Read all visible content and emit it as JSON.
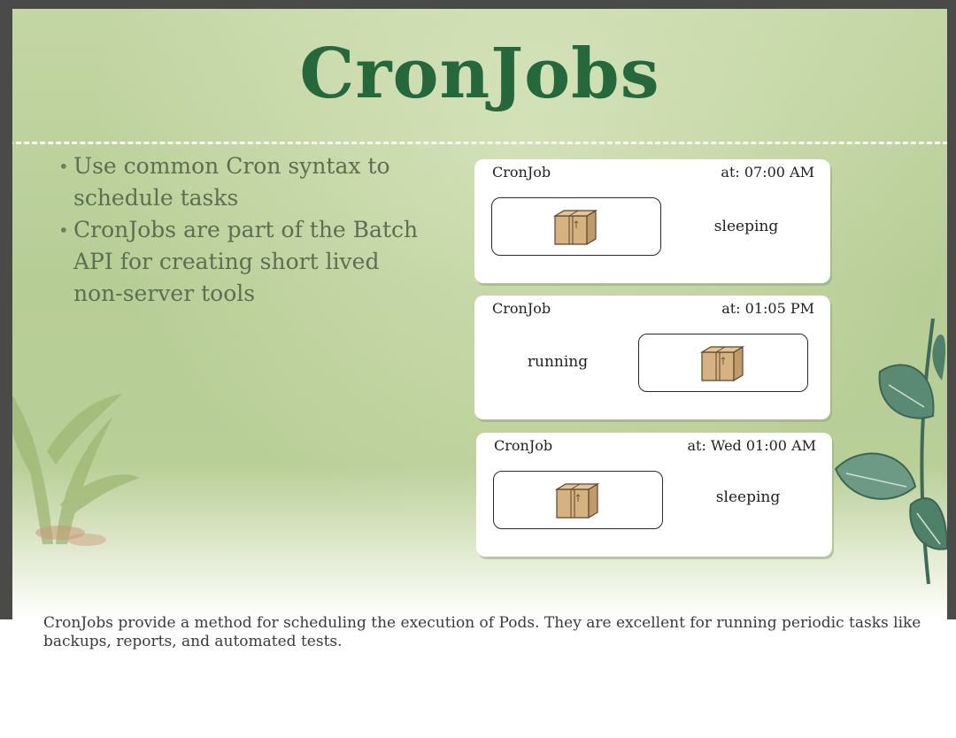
{
  "slide": {
    "title": "CronJobs",
    "bullets": [
      "Use common Cron syntax to schedule tasks",
      "CronJobs are part of the Batch API for creating short lived non-server tools"
    ]
  },
  "cronjobs": [
    {
      "name": "CronJob",
      "schedule": "at: 07:00 AM",
      "state": "sleeping"
    },
    {
      "name": "CronJob",
      "schedule": "at: 01:05 PM",
      "state": "running"
    },
    {
      "name": "CronJob",
      "schedule": "at: Wed 01:00 AM",
      "state": "sleeping"
    }
  ],
  "caption": "CronJobs provide a method for scheduling the execution of Pods. They are excellent for running periodic tasks like backups, reports, and automated tests.",
  "icons": [
    "package-icon",
    "plant-left-decoration",
    "plant-right-decoration"
  ],
  "colors": {
    "title": "#24683c",
    "slide_background": "#bcd19c",
    "bullet_text": "#5d6e52",
    "card_background": "#ffffff",
    "frame": "#4a4a48"
  }
}
